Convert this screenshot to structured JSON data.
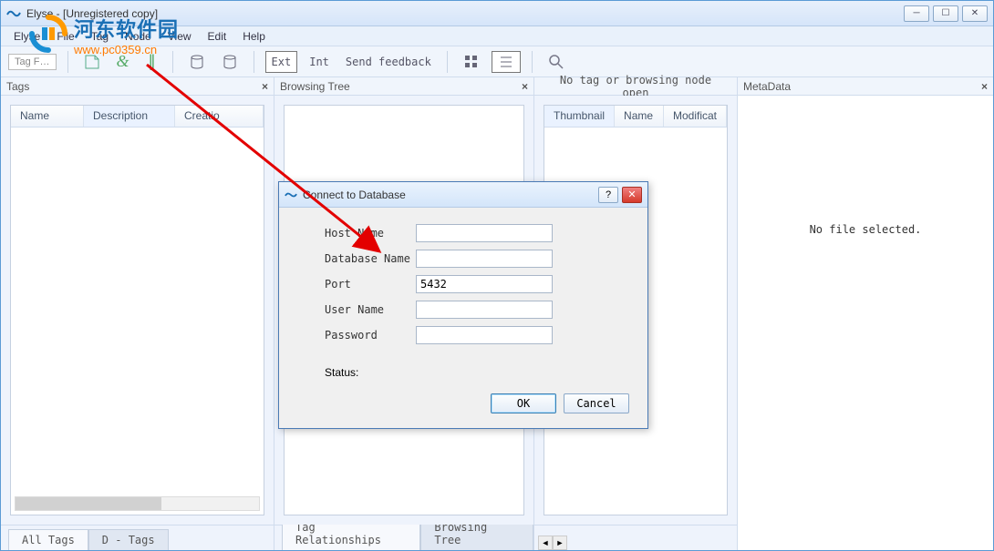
{
  "window": {
    "title": "Elyse - [Unregistered copy]"
  },
  "menu": {
    "items": [
      "Elyse",
      "File",
      "Tag",
      "Node",
      "View",
      "Edit",
      "Help"
    ]
  },
  "toolbar": {
    "tag_filter_label": "Tag F…",
    "ext_label": "Ext",
    "int_label": "Int",
    "feedback_label": "Send feedback"
  },
  "panels": {
    "tags": {
      "title": "Tags",
      "columns": [
        "Name",
        "Description",
        "Creatio"
      ],
      "bottom_tabs": [
        "All Tags",
        "D - Tags"
      ]
    },
    "browsing": {
      "title": "Browsing Tree",
      "bottom_tabs": [
        "Tag Relationships",
        "Browsing Tree"
      ]
    },
    "list": {
      "heading": "No tag or browsing node open",
      "columns": [
        "Thumbnail",
        "Name",
        "Modificat"
      ]
    },
    "metadata": {
      "title": "MetaData",
      "empty_text": "No file selected."
    }
  },
  "dialog": {
    "title": "Connect to Database",
    "fields": {
      "host_label": "Host Name",
      "host_value": "",
      "db_label": "Database Name",
      "db_value": "",
      "port_label": "Port",
      "port_value": "5432",
      "user_label": "User Name",
      "user_value": "",
      "pass_label": "Password",
      "pass_value": ""
    },
    "status_label": "Status:",
    "ok_label": "OK",
    "cancel_label": "Cancel"
  },
  "watermark": {
    "line1": "河东软件园",
    "line2": "www.pc0359.cn"
  }
}
